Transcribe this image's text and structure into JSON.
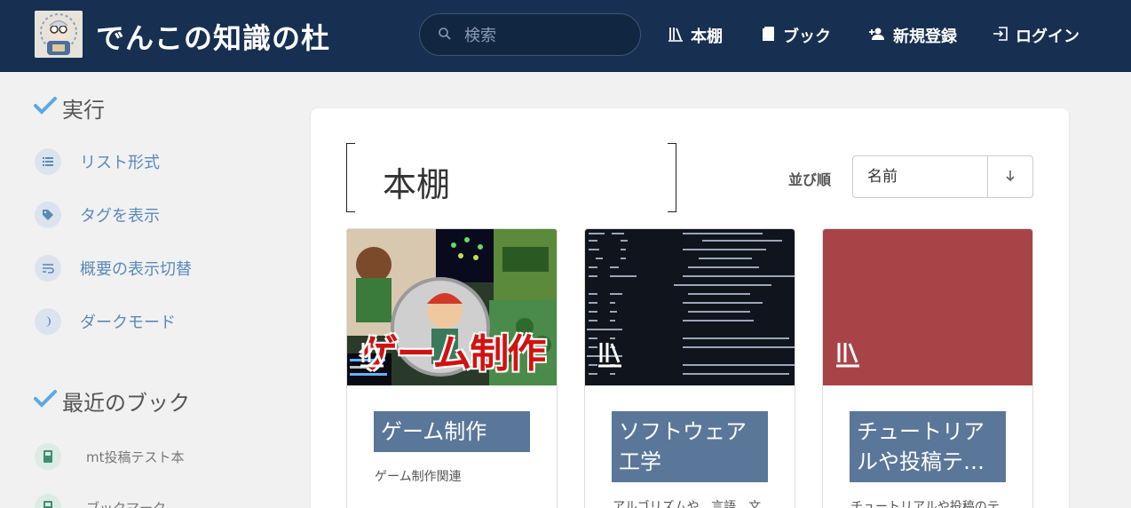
{
  "header": {
    "site_title": "でんこの知識の杜",
    "search_placeholder": "検索",
    "nav": {
      "shelf": "本棚",
      "books": "ブック",
      "register": "新規登録",
      "login": "ログイン"
    },
    "colors": {
      "background": "#173052",
      "search_bg": "#112641"
    }
  },
  "sidebar": {
    "actions_heading": "実行",
    "actions": [
      {
        "label": "リスト形式",
        "icon": "list-icon"
      },
      {
        "label": "タグを表示",
        "icon": "tag-icon"
      },
      {
        "label": "概要の表示切替",
        "icon": "text-wrap-icon"
      },
      {
        "label": "ダークモード",
        "icon": "moon-icon"
      }
    ],
    "recent_heading": "最近のブック",
    "recent_books": [
      {
        "label": "mt投稿テスト本",
        "icon": "book-icon"
      },
      {
        "label": "ブックマーク",
        "icon": "book-icon"
      }
    ]
  },
  "main": {
    "page_title": "本棚",
    "sort_label": "並び順",
    "sort_value": "名前",
    "sort_direction_icon": "arrow-down-icon",
    "books": [
      {
        "title": "ゲーム制作",
        "description": "ゲーム制作関連",
        "cover_text": "ゲーム制作"
      },
      {
        "title": "ソフトウェア工学",
        "description": "アルゴリズムや、言語、文",
        "cover_color": "#10141c"
      },
      {
        "title": "チュートリアルや投稿テ…",
        "description": "チュートリアルや投稿のテ",
        "cover_color": "#a84447"
      }
    ]
  }
}
